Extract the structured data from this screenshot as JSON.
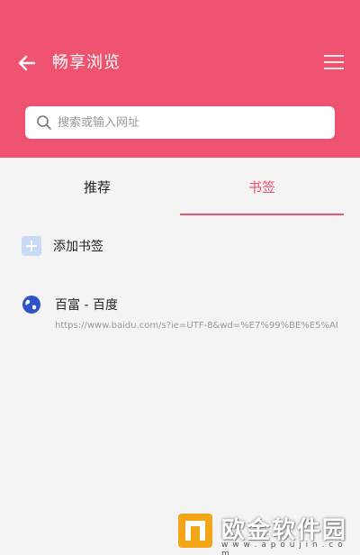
{
  "header": {
    "title": "畅享浏览",
    "back_icon": "arrow-left-icon",
    "menu_icon": "hamburger-menu-icon",
    "background_color": "#f0536f"
  },
  "search": {
    "placeholder": "搜索或输入网址",
    "value": ""
  },
  "tabs": [
    {
      "label": "推荐",
      "active": false
    },
    {
      "label": "书签",
      "active": true
    }
  ],
  "bookmarks": {
    "add_label": "添加书签",
    "items": [
      {
        "title": "百富 - 百度",
        "url": "https://www.baidu.com/s?ie=UTF-8&wd=%E7%99%BE%E5%AF%8...",
        "icon": "globe-icon"
      }
    ]
  },
  "watermark": {
    "brand": "欧金软件园",
    "url": "w w w . a p o u j i n . c o m"
  },
  "colors": {
    "accent": "#f0536f",
    "add_icon_bg": "#c9daf7",
    "globe": "#2f54c9"
  }
}
